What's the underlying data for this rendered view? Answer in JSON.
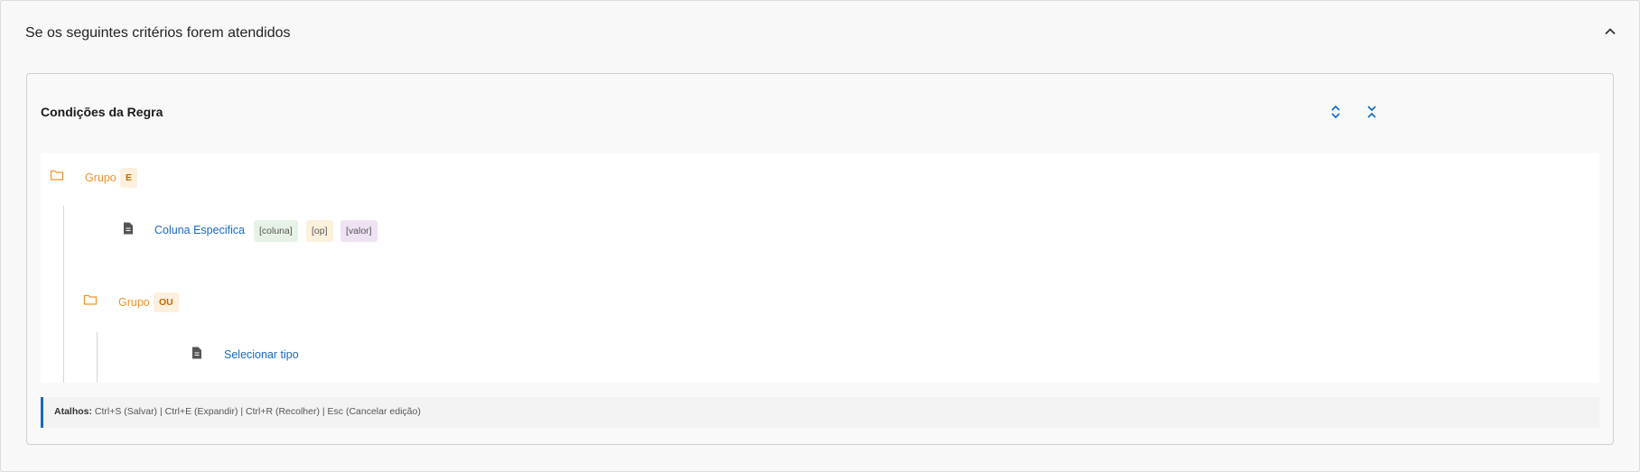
{
  "section": {
    "title": "Se os seguintes critérios forem atendidos",
    "collapse_icon": "chevron-up-icon"
  },
  "card": {
    "title": "Condições da Regra",
    "expand_icon": "expand-all-icon",
    "collapse_icon": "collapse-all-icon"
  },
  "tree": {
    "root_group": {
      "label": "Grupo",
      "operator": "E"
    },
    "condition": {
      "label": "Coluna Especifica",
      "chips": [
        "[coluna]",
        "[op]",
        "[valor]"
      ]
    },
    "sub_group": {
      "label": "Grupo",
      "operator": "OU"
    },
    "sub_condition": {
      "label": "Selecionar tipo"
    }
  },
  "footer": {
    "prefix": "Atalhos:",
    "text": "Ctrl+S (Salvar) | Ctrl+E (Expandir) | Ctrl+R (Recolher) | Esc (Cancelar edição)"
  },
  "colors": {
    "accent": "#1769c2",
    "group": "#f0932b",
    "chip_column": "#e6f2e6",
    "chip_op": "#fdf0dc",
    "chip_value": "#efe3f3"
  }
}
